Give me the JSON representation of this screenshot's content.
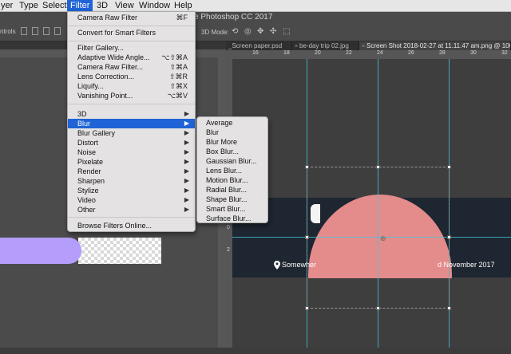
{
  "menubar": {
    "items": [
      "yer",
      "Type",
      "Select",
      "Filter",
      "3D",
      "View",
      "Window",
      "Help"
    ],
    "active": "Filter"
  },
  "app": {
    "title": "e Photoshop CC 2017"
  },
  "optbar": {
    "controls_label": "ntrols",
    "mode_label": "3D Mode:"
  },
  "tabs": [
    {
      "label": "_Screen paper.psd"
    },
    {
      "label": "be-day trip 02.jpg"
    },
    {
      "label": "Screen Shot 2018-02-27 at 11.11.47 am.png @ 100% (R"
    }
  ],
  "ruler": {
    "h_marks": [
      "16",
      "18",
      "20",
      "22",
      "24",
      "26",
      "28",
      "30",
      "32"
    ],
    "v_marks": [
      "8",
      "0",
      "2"
    ]
  },
  "canvas": {
    "location_text": "Somewher",
    "date_text": "d November 2017",
    "accent_color": "#e48b8b",
    "band_color": "#1e2631",
    "guide_color": "#3fc7d8"
  },
  "filter_menu": {
    "items": [
      {
        "label": "Camera Raw Filter",
        "shortcut": "⌘F"
      },
      {
        "label": "Convert for Smart Filters"
      },
      {
        "label": "Filter Gallery..."
      },
      {
        "label": "Adaptive Wide Angle...",
        "shortcut": "⌥⇧⌘A"
      },
      {
        "label": "Camera Raw Filter...",
        "shortcut": "⇧⌘A"
      },
      {
        "label": "Lens Correction...",
        "shortcut": "⇧⌘R"
      },
      {
        "label": "Liquify...",
        "shortcut": "⇧⌘X"
      },
      {
        "label": "Vanishing Point...",
        "shortcut": "⌥⌘V"
      },
      {
        "label": "3D",
        "submenu": true
      },
      {
        "label": "Blur",
        "submenu": true,
        "highlighted": true
      },
      {
        "label": "Blur Gallery",
        "submenu": true
      },
      {
        "label": "Distort",
        "submenu": true
      },
      {
        "label": "Noise",
        "submenu": true
      },
      {
        "label": "Pixelate",
        "submenu": true
      },
      {
        "label": "Render",
        "submenu": true
      },
      {
        "label": "Sharpen",
        "submenu": true
      },
      {
        "label": "Stylize",
        "submenu": true
      },
      {
        "label": "Video",
        "submenu": true
      },
      {
        "label": "Other",
        "submenu": true
      },
      {
        "label": "Browse Filters Online..."
      }
    ]
  },
  "blur_menu": {
    "items": [
      "Average",
      "Blur",
      "Blur More",
      "Box Blur...",
      "Gaussian Blur...",
      "Lens Blur...",
      "Motion Blur...",
      "Radial Blur...",
      "Shape Blur...",
      "Smart Blur...",
      "Surface Blur..."
    ]
  }
}
